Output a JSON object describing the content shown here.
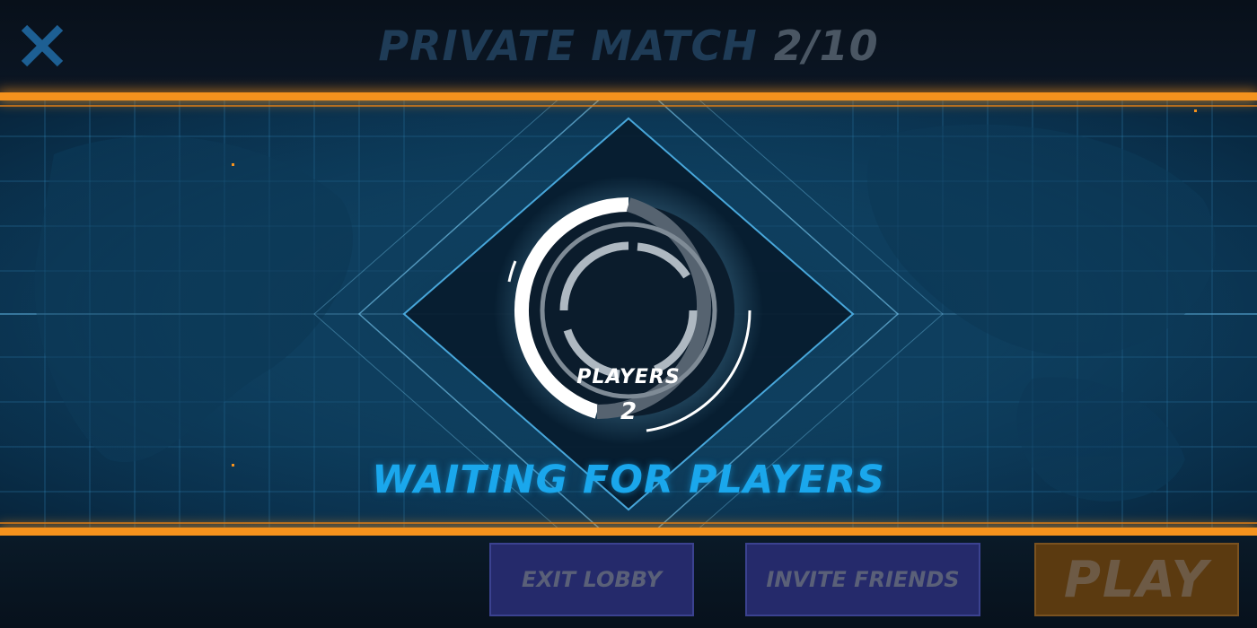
{
  "header": {
    "title": "PRIVATE MATCH",
    "player_count": "2/10",
    "close_icon": "close-x-icon"
  },
  "lobby": {
    "players_label": "PLAYERS",
    "players_value": "2",
    "status_text": "WAITING FOR PLAYERS",
    "ring_icon": "player-count-ring-gauge"
  },
  "footer": {
    "exit_label": "EXIT LOBBY",
    "invite_label": "INVITE FRIENDS",
    "play_label": "PLAY"
  },
  "colors": {
    "accent_orange": "#f5921d",
    "status_blue": "#1aa7ec",
    "button_purple": "#252a6b",
    "play_brown": "#5b3a10"
  }
}
